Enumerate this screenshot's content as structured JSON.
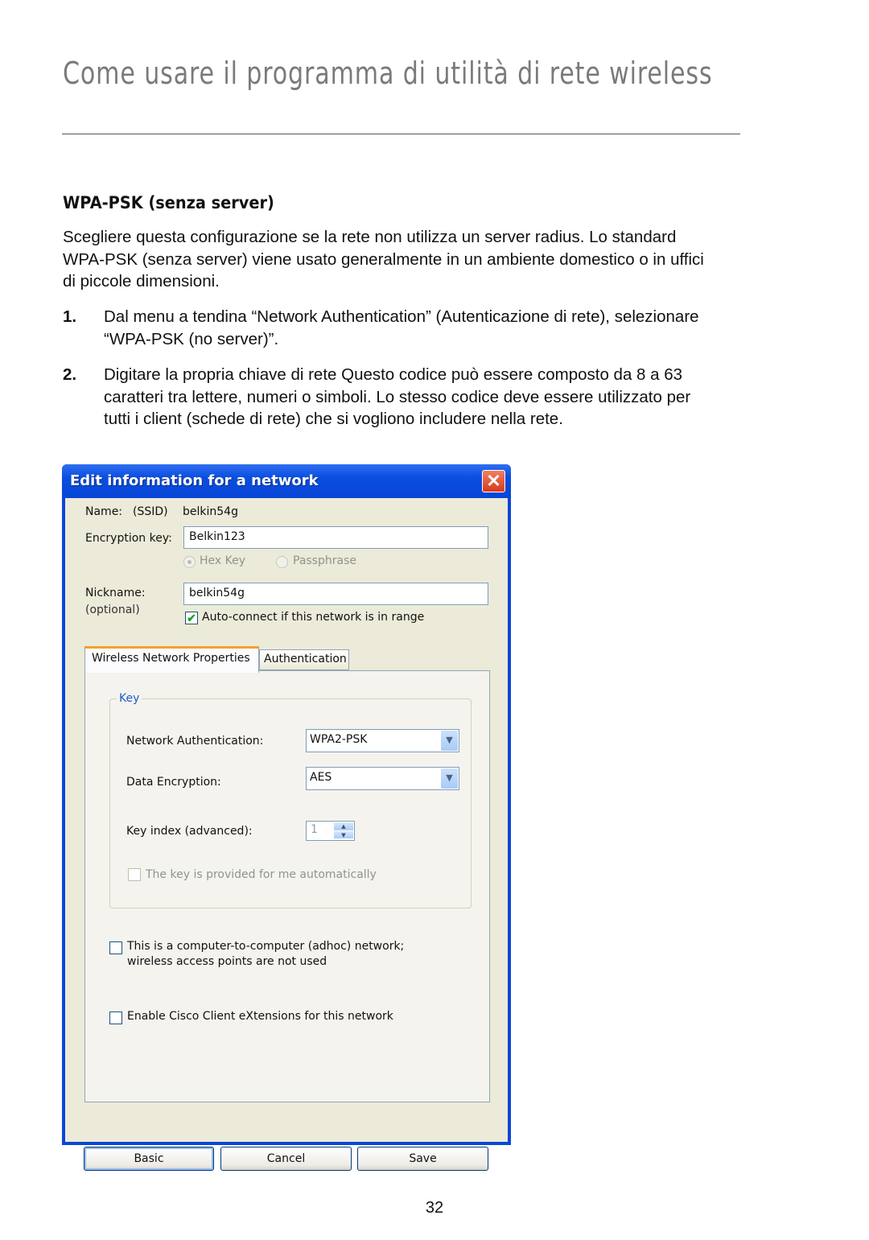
{
  "page": {
    "title": "Come usare il programma di utilità di rete wireless",
    "section_heading": "WPA-PSK (senza server)",
    "intro": "Scegliere questa configurazione se la rete non utilizza un server radius. Lo standard WPA-PSK (senza server) viene usato generalmente in un ambiente domestico o in uffici di piccole dimensioni.",
    "steps": [
      {
        "number": "1.",
        "text": "Dal menu a tendina “Network Authentication” (Autenticazione di rete), selezionare “WPA-PSK (no server)”."
      },
      {
        "number": "2.",
        "text": "Digitare la propria chiave di rete Questo codice può essere composto da 8 a 63 caratteri tra lettere, numeri o simboli. Lo stesso codice deve essere utilizzato per tutti i client (schede di rete) che si vogliono includere nella rete."
      }
    ],
    "page_number": "32"
  },
  "dialog": {
    "title": "Edit information for a network",
    "close_glyph": "✕",
    "name_label": "Name:",
    "ssid_label": "(SSID)",
    "ssid_value": "belkin54g",
    "encryption_key_label": "Encryption key:",
    "encryption_key_value": "Belkin123",
    "key_type_options": [
      {
        "label": "Hex Key",
        "selected": true,
        "disabled": true
      },
      {
        "label": "Passphrase",
        "selected": false,
        "disabled": true
      }
    ],
    "nickname_label": "Nickname:",
    "nickname_optional": "(optional)",
    "nickname_value": "belkin54g",
    "auto_connect_label": "Auto-connect if this network is in range",
    "auto_connect_checked": true,
    "check_glyph": "✔",
    "tabs": [
      {
        "label": "Wireless Network Properties",
        "active": true
      },
      {
        "label": "Authentication",
        "active": false
      }
    ],
    "key_group": {
      "legend": "Key",
      "network_auth_label": "Network Authentication:",
      "network_auth_value": "WPA2-PSK",
      "data_encryption_label": "Data Encryption:",
      "data_encryption_value": "AES",
      "key_index_label": "Key index (advanced):",
      "key_index_value": "1",
      "auto_key_label": "The key is provided for me automatically",
      "auto_key_checked": false
    },
    "adhoc_label_line1": "This is a computer-to-computer (adhoc) network;",
    "adhoc_label_line2": "wireless access points are not used",
    "adhoc_checked": false,
    "cisco_label": "Enable Cisco Client eXtensions for this network",
    "cisco_checked": false,
    "dropdown_glyph": "▼",
    "spin_up_glyph": "▲",
    "spin_down_glyph": "▼",
    "buttons": {
      "basic": "Basic",
      "cancel": "Cancel",
      "save": "Save"
    }
  }
}
